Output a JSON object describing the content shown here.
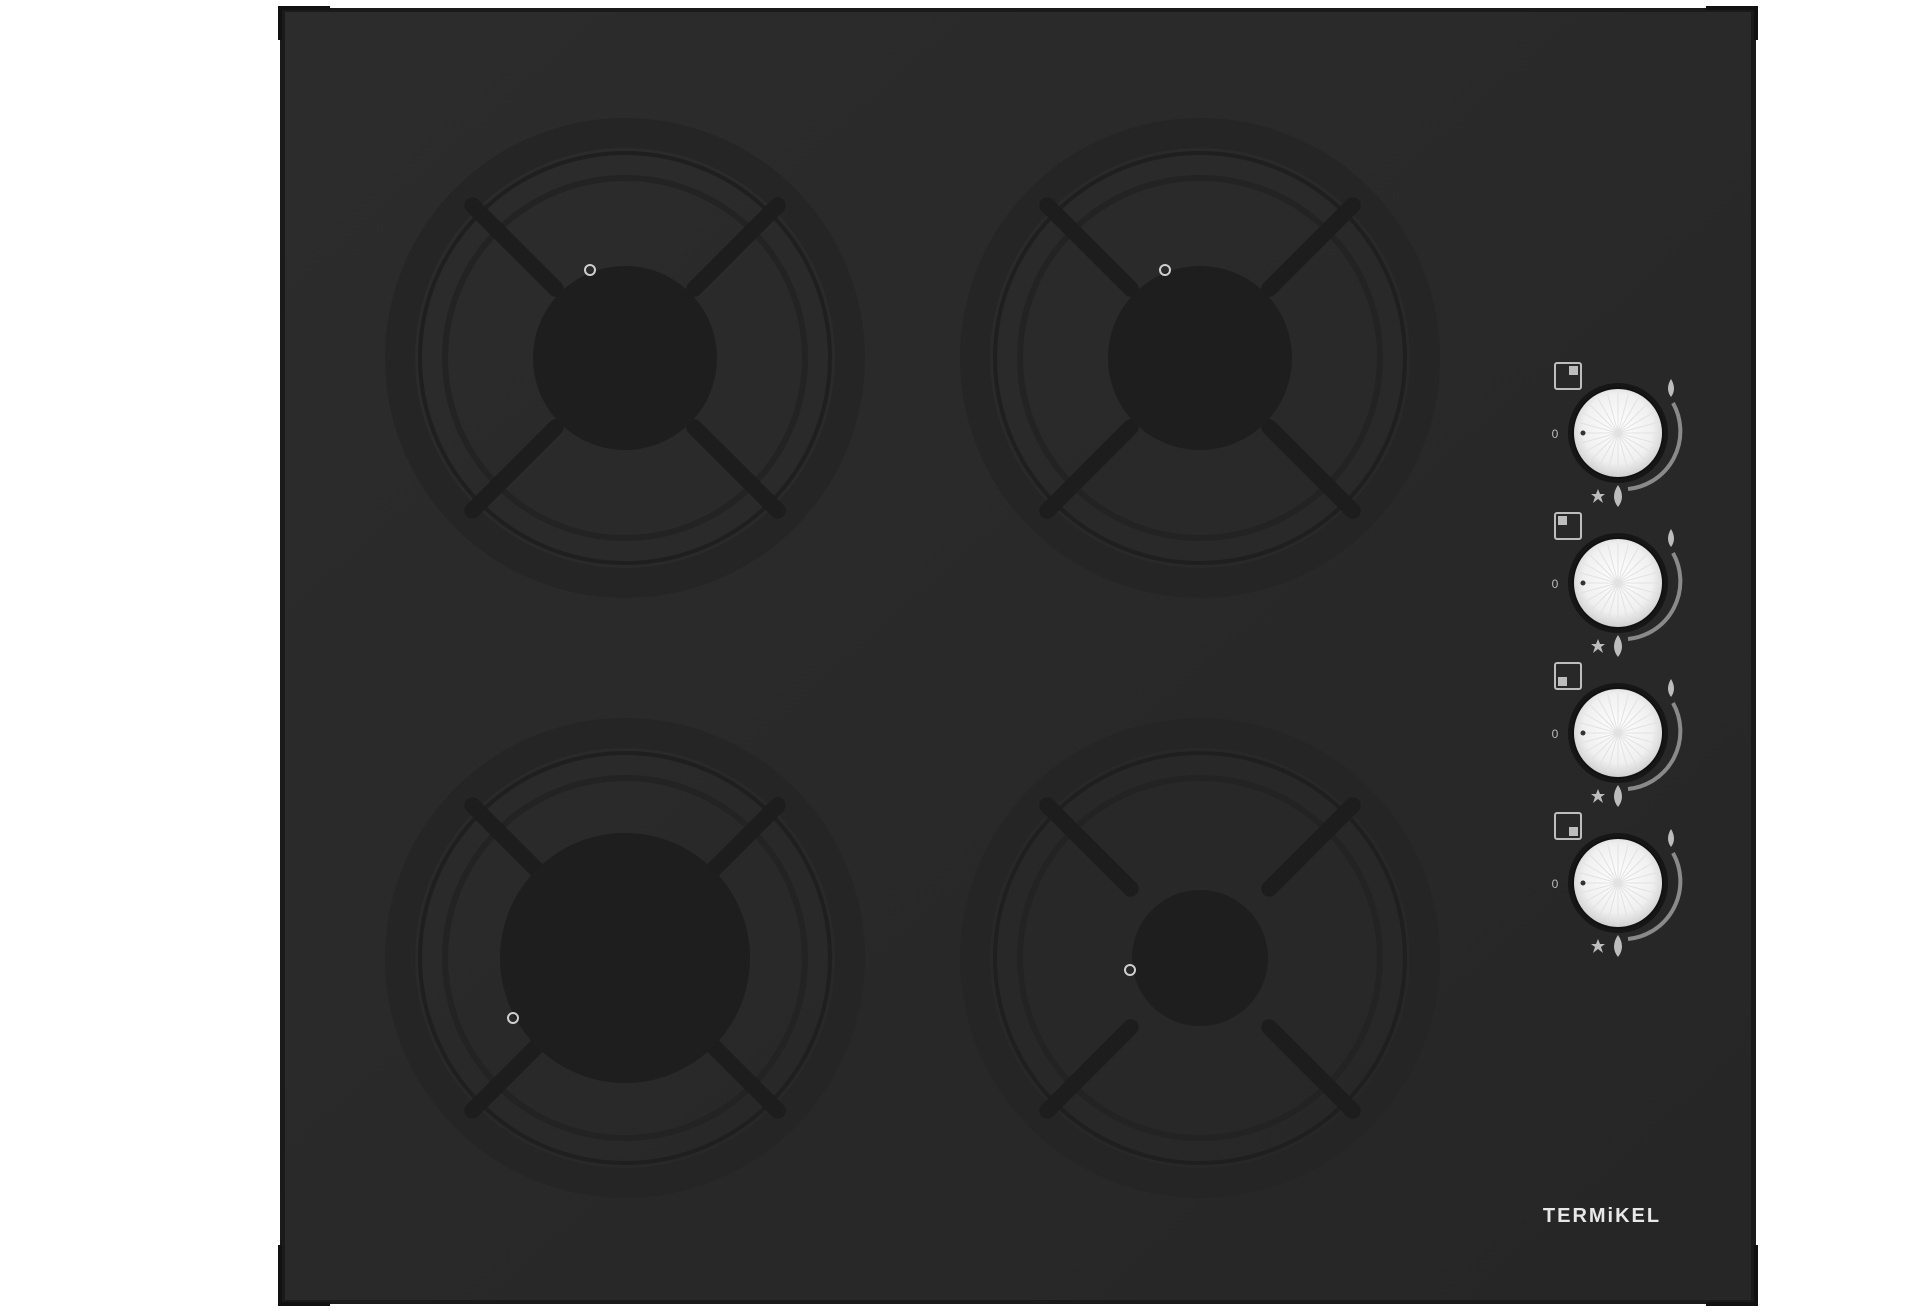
{
  "product": {
    "brand": "TERMiKEL",
    "burners": [
      {
        "id": "rear-left",
        "position": "rear-left",
        "size": "large"
      },
      {
        "id": "rear-right",
        "position": "rear-right",
        "size": "large"
      },
      {
        "id": "front-left",
        "position": "front-left",
        "size": "large"
      },
      {
        "id": "front-right",
        "position": "front-right",
        "size": "small"
      }
    ],
    "knobs": [
      {
        "id": "knob-1",
        "controls": "rear-right",
        "off_mark": "0"
      },
      {
        "id": "knob-2",
        "controls": "rear-left",
        "off_mark": "0"
      },
      {
        "id": "knob-3",
        "controls": "front-left",
        "off_mark": "0"
      },
      {
        "id": "knob-4",
        "controls": "front-right",
        "off_mark": "0"
      }
    ]
  },
  "colors": {
    "glass": "#2a2a2a",
    "frame": "#1c1c1c",
    "grate": "#202020",
    "knob": "#f2f2f2",
    "brand_text": "#e8e8e8",
    "markings": "#bdbdbd",
    "background": "#ffffff"
  }
}
